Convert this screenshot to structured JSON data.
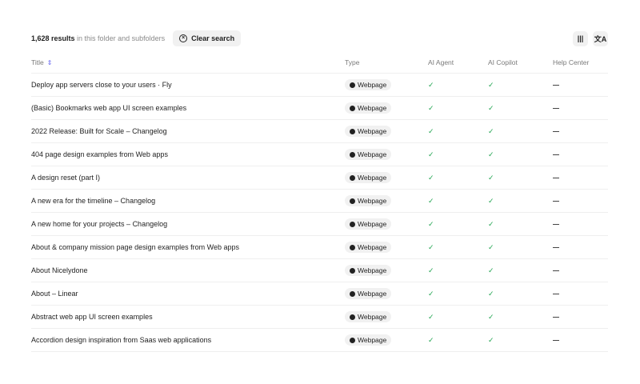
{
  "summary": {
    "count": "1,628 results",
    "suffix": " in this folder and subfolders"
  },
  "clear_label": "Clear search",
  "toolbar": {
    "columns_icon": "columns-icon",
    "translate_icon": "translate-icon"
  },
  "columns": {
    "title": "Title",
    "type": "Type",
    "agent": "AI Agent",
    "copilot": "AI Copilot",
    "help": "Help Center"
  },
  "rows": [
    {
      "title": "Deploy app servers close to your users · Fly",
      "type": "Webpage"
    },
    {
      "title": "(Basic) Bookmarks web app UI screen examples",
      "type": "Webpage"
    },
    {
      "title": "2022 Release: Built for Scale – Changelog",
      "type": "Webpage"
    },
    {
      "title": "404 page design examples from Web apps",
      "type": "Webpage"
    },
    {
      "title": "A design reset (part I)",
      "type": "Webpage"
    },
    {
      "title": "A new era for the timeline – Changelog",
      "type": "Webpage"
    },
    {
      "title": "A new home for your projects – Changelog",
      "type": "Webpage"
    },
    {
      "title": "About & company mission page design examples from Web apps",
      "type": "Webpage"
    },
    {
      "title": "About Nicelydone",
      "type": "Webpage"
    },
    {
      "title": "About – Linear",
      "type": "Webpage"
    },
    {
      "title": "Abstract web app UI screen examples",
      "type": "Webpage"
    },
    {
      "title": "Accordion design inspiration from Saas web applications",
      "type": "Webpage"
    }
  ],
  "colors": {
    "check": "#22a552",
    "sort": "#6b6bf0"
  }
}
